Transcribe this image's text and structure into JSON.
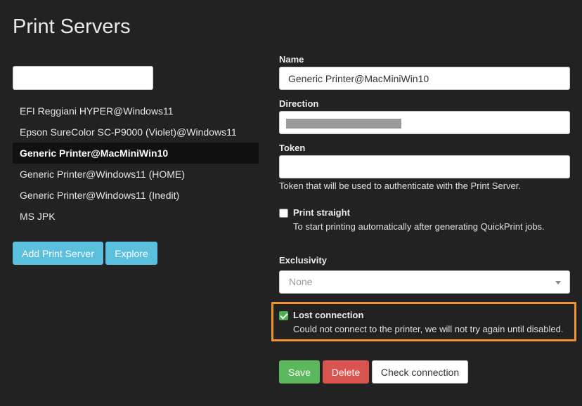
{
  "page_title": "Print Servers",
  "search": {
    "value": "",
    "placeholder": ""
  },
  "servers": [
    {
      "label": "EFI Reggiani HYPER@Windows11",
      "active": false
    },
    {
      "label": "Epson SureColor SC-P9000 (Violet)@Windows11",
      "active": false
    },
    {
      "label": "Generic Printer@MacMiniWin10",
      "active": true
    },
    {
      "label": "Generic Printer@Windows11 (HOME)",
      "active": false
    },
    {
      "label": "Generic Printer@Windows11 (Inedit)",
      "active": false
    },
    {
      "label": "MS JPK",
      "active": false
    }
  ],
  "buttons": {
    "add": "Add Print Server",
    "explore": "Explore"
  },
  "form": {
    "name_label": "Name",
    "name_value": "Generic Printer@MacMiniWin10",
    "direction_label": "Direction",
    "direction_value": "",
    "token_label": "Token",
    "token_value": "",
    "token_help": "Token that will be used to authenticate with the Print Server.",
    "print_straight": {
      "title": "Print straight",
      "desc": "To start printing automatically after generating QuickPrint jobs.",
      "checked": false
    },
    "exclusivity_label": "Exclusivity",
    "exclusivity_value": "None",
    "lost_connection": {
      "title": "Lost connection",
      "desc": "Could not connect to the printer, we will not try again until disabled.",
      "checked": true
    },
    "save_label": "Save",
    "delete_label": "Delete",
    "check_label": "Check connection"
  },
  "colors": {
    "background": "#222222",
    "info": "#5bc0de",
    "success": "#5cb85c",
    "danger": "#d9534f",
    "highlight": "#f0922d"
  }
}
